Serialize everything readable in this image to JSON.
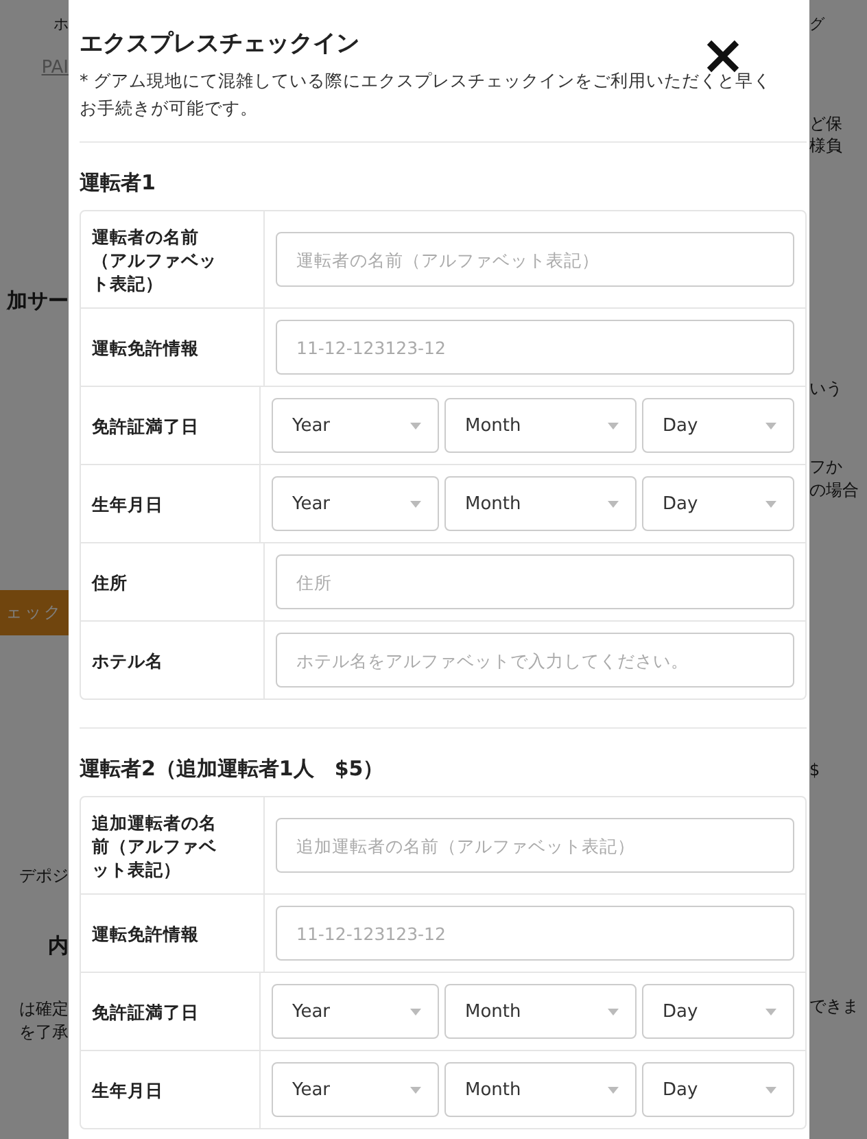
{
  "background": {
    "left": [
      {
        "text": "ホ",
        "kind": "small"
      },
      {
        "text": "PAI",
        "kind": "link"
      },
      {
        "text": "加サー",
        "kind": "heading"
      },
      {
        "text": "ェック",
        "kind": "button"
      },
      {
        "text": "デポジ",
        "kind": "body"
      },
      {
        "text": "内",
        "kind": "heading"
      },
      {
        "text": "は確定",
        "kind": "body"
      },
      {
        "text": "を了承",
        "kind": "body"
      }
    ],
    "right": [
      {
        "text": "グ",
        "kind": "small"
      },
      {
        "text": "ど保",
        "kind": "body"
      },
      {
        "text": "様負",
        "kind": "body"
      },
      {
        "text": "いう",
        "kind": "body"
      },
      {
        "text": "フか",
        "kind": "body"
      },
      {
        "text": "の場合",
        "kind": "body"
      },
      {
        "text": "$",
        "kind": "body"
      },
      {
        "text": "できま",
        "kind": "body"
      }
    ]
  },
  "modal": {
    "title": "エクスプレスチェックイン",
    "note": "* グアム現地にて混雑している際にエクスプレスチェックインをご利用いただくと早くお手続きが可能です。",
    "sections": [
      {
        "title": "運転者1",
        "rows": [
          {
            "label": "運転者の名前（アルファベット表記）",
            "kind": "text",
            "placeholder": "運転者の名前（アルファベット表記）"
          },
          {
            "label": "運転免許情報",
            "kind": "text",
            "placeholder": "11-12-123123-12"
          },
          {
            "label": "免許証満了日",
            "kind": "date",
            "selects": [
              "Year",
              "Month",
              "Day"
            ]
          },
          {
            "label": "生年月日",
            "kind": "date",
            "selects": [
              "Year",
              "Month",
              "Day"
            ]
          },
          {
            "label": "住所",
            "kind": "text",
            "placeholder": "住所"
          },
          {
            "label": "ホテル名",
            "kind": "text",
            "placeholder": "ホテル名をアルファベットで入力してください。"
          }
        ]
      },
      {
        "title": "運転者2（追加運転者1人　$5）",
        "rows": [
          {
            "label": "追加運転者の名前（アルファベット表記）",
            "kind": "text",
            "placeholder": "追加運転者の名前（アルファベット表記）"
          },
          {
            "label": "運転免許情報",
            "kind": "text",
            "placeholder": "11-12-123123-12"
          },
          {
            "label": "免許証満了日",
            "kind": "date",
            "selects": [
              "Year",
              "Month",
              "Day"
            ]
          },
          {
            "label": "生年月日",
            "kind": "date",
            "selects": [
              "Year",
              "Month",
              "Day"
            ]
          }
        ]
      }
    ]
  }
}
